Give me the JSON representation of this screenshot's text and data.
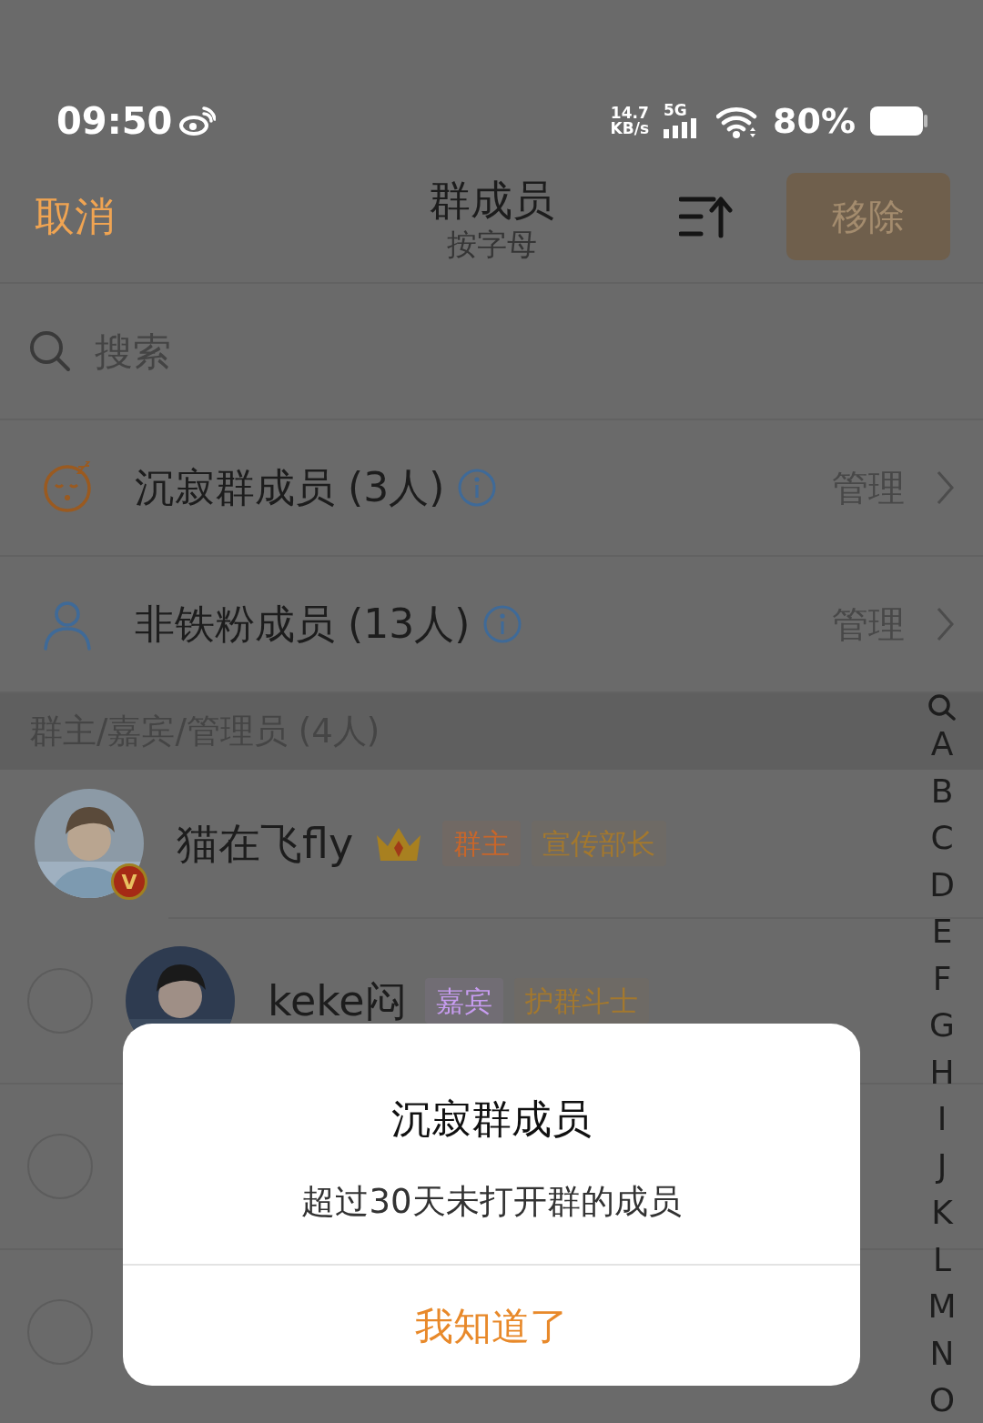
{
  "status_bar": {
    "time": "09:50",
    "net_speed": "14.7",
    "net_unit": "KB/s",
    "network": "5G",
    "battery": "80%"
  },
  "header": {
    "cancel": "取消",
    "title": "群成员",
    "subtitle": "按字母",
    "remove": {
      "label": "移除",
      "disabled": true
    }
  },
  "search": {
    "placeholder": "搜索"
  },
  "categories": [
    {
      "kind": "inactive",
      "label": "沉寂群成员 (3人)",
      "action": "管理"
    },
    {
      "kind": "non_fan",
      "label": "非铁粉成员 (13人)",
      "action": "管理"
    }
  ],
  "section": {
    "title": "群主/嘉宾/管理员 (4人)"
  },
  "members": [
    {
      "kind": "owner",
      "name": "猫在飞fly",
      "verified_mark": "V",
      "crown": true,
      "tags": [
        {
          "label": "群主",
          "color": "#c8662a"
        },
        {
          "label": "宣传部长",
          "color": "#a3782e"
        }
      ]
    },
    {
      "kind": "member",
      "checked": false,
      "name": "keke闷",
      "crown": false,
      "tags": [
        {
          "label": "嘉宾",
          "color": "#c79cf0"
        },
        {
          "label": "护群斗士",
          "color": "#a3782e"
        }
      ]
    },
    {
      "kind": "member",
      "checked": false
    },
    {
      "kind": "member",
      "checked": false
    }
  ],
  "index": [
    "A",
    "B",
    "C",
    "D",
    "E",
    "F",
    "G",
    "H",
    "I",
    "J",
    "K",
    "L",
    "M",
    "N",
    "O"
  ],
  "dialog": {
    "title": "沉寂群成员",
    "message": "超过30天未打开群的成员",
    "button": "我知道了"
  }
}
